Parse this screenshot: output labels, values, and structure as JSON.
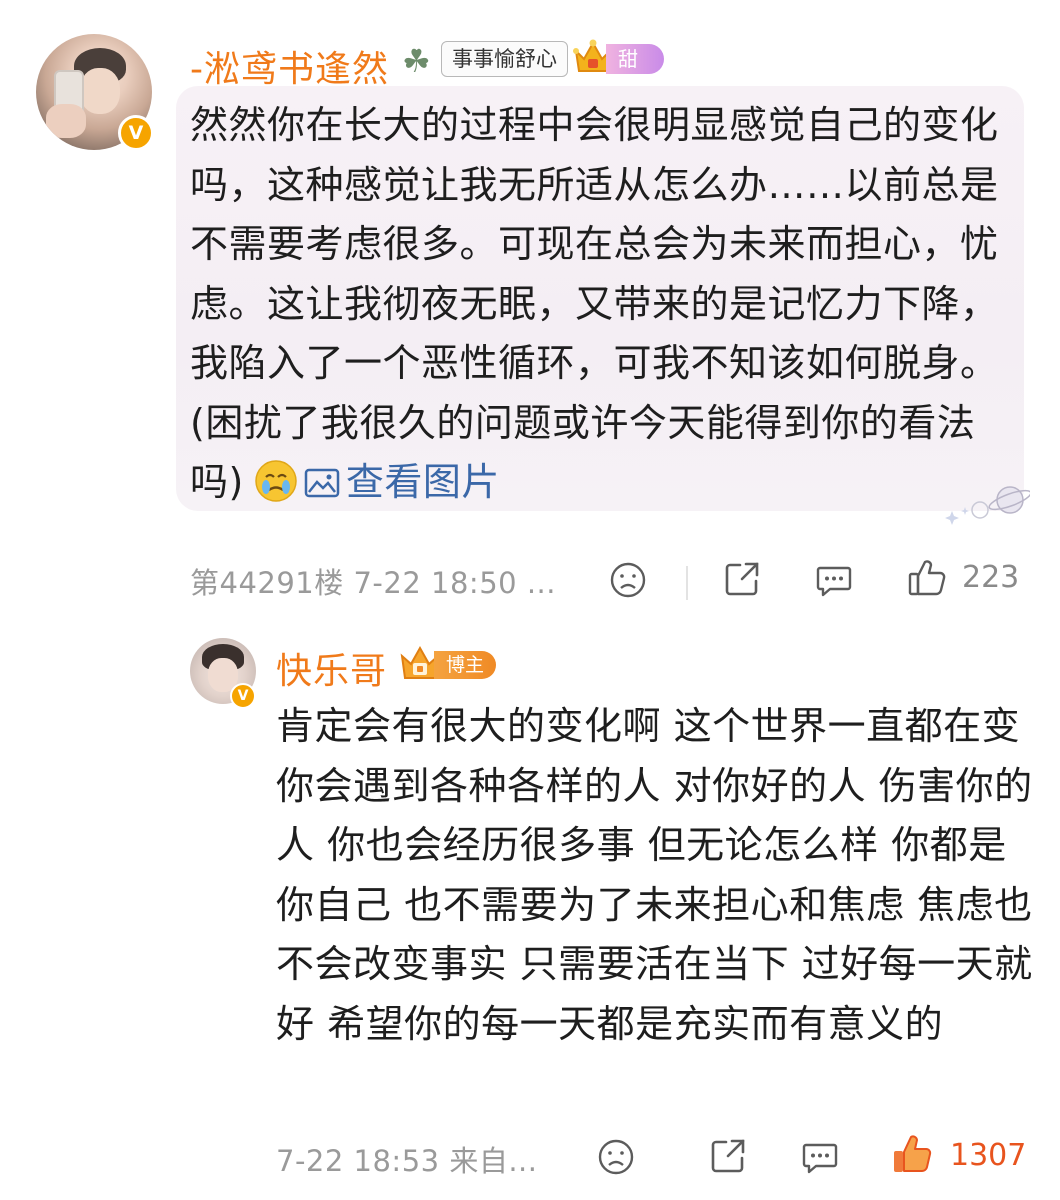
{
  "comment": {
    "username": "-淞鸢书逢然",
    "fan_badge_icon": "clover-icon",
    "fan_badge_text": "事事愉舒心",
    "vip_label": "甜粥",
    "text": "然然你在长大的过程中会很明显感觉自己的变化吗，这种感觉让我无所适从怎么办……以前总是不需要考虑很多。可现在总会为未来而担心，忧虑。这让我彻夜无眠，又带来的是记忆力下降，我陷入了一个恶性循环，可我不知该如何脱身。(困扰了我很久的问题或许今天能得到你的看法吗)",
    "view_image_label": "查看图片",
    "floor": "第44291楼",
    "time": "7-22 18:50",
    "more": "...",
    "like_count": "223",
    "username_color": "#f07a1a",
    "link_color": "#3b68a8"
  },
  "reply": {
    "username": "快乐哥",
    "host_badge": "博主",
    "text": "肯定会有很大的变化啊 这个世界一直都在变 你会遇到各种各样的人 对你好的人 伤害你的人  你也会经历很多事  但无论怎么样 你都是你自己 也不需要为了未来担心和焦虑 焦虑也不会改变事实 只需要活在当下 过好每一天就好 希望你的每一天都是充实而有意义的",
    "time": "7-22 18:53",
    "source": "来自...",
    "like_count": "1307",
    "like_color": "#e8541e"
  },
  "verified_badge": "V"
}
